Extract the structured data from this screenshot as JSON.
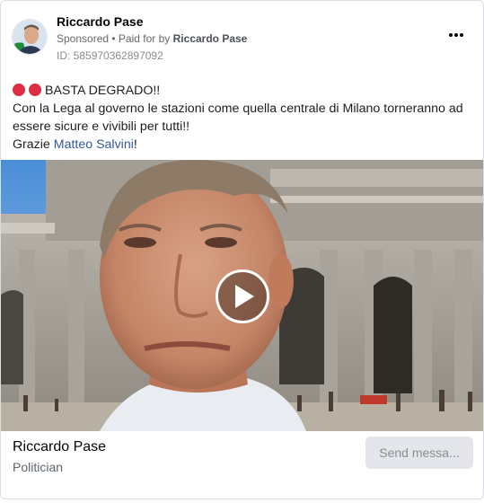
{
  "header": {
    "page_name": "Riccardo Pase",
    "sponsored": "Sponsored",
    "paid_for_prefix": "• Paid for by",
    "paid_for_name": "Riccardo Pase",
    "ad_id": "ID: 585970362897092",
    "more_icon": "more-horizontal-icon"
  },
  "post": {
    "line1": "BASTA DEGRADO!!",
    "line2": "Con la Lega al governo le stazioni come quella centrale di Milano torneranno ad",
    "line3": "essere sicure e vivibili per tutti!!",
    "line4_prefix": "Grazie",
    "line4_mention": "Matteo Salvini",
    "line4_suffix": "!",
    "emoji_color": "#dd2e44"
  },
  "media": {
    "type": "video",
    "play_icon": "play-icon"
  },
  "footer": {
    "page_name": "Riccardo Pase",
    "category": "Politician",
    "cta_label": "Send messa..."
  }
}
